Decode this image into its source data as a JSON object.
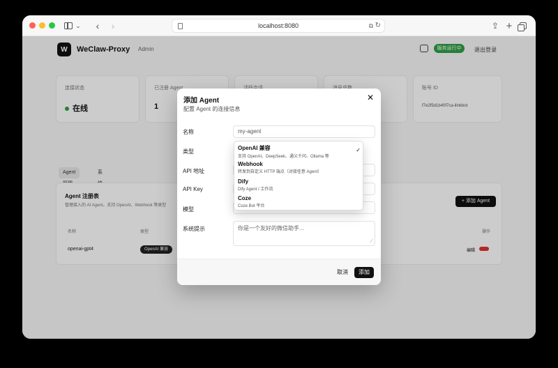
{
  "browser": {
    "url": "localhost:8080"
  },
  "app": {
    "name": "WeClaw-Proxy",
    "admin_label": "Admin",
    "status_pill": "服务运行中",
    "logout": "退出登录"
  },
  "stats": [
    {
      "label": "连接状态",
      "value": "在线"
    },
    {
      "label": "已注册 Agent",
      "value": "1"
    },
    {
      "label": "活跃会话",
      "value": ""
    },
    {
      "label": "消息总数",
      "value": ""
    },
    {
      "label": "账号 ID",
      "value": "f7e2f5d1b40f7ca-ilinkbot"
    }
  ],
  "tabs": [
    "Agent 管理",
    "系统状态"
  ],
  "agent_panel": {
    "title": "Agent 注册表",
    "desc": "管理接入的 AI Agent，支持 OpenAI、Webhook 等类型",
    "add_button": "+ 添加 Agent",
    "columns": [
      "名称",
      "类型",
      "操作"
    ],
    "row": {
      "name": "openai-gpt4",
      "type": "OpenAI 兼容",
      "edit": "编辑"
    }
  },
  "modal": {
    "title": "添加 Agent",
    "subtitle": "配置 Agent 的连接信息",
    "fields": {
      "name_label": "名称",
      "name_value": "my-agent",
      "type_label": "类型",
      "api_label": "API 地址",
      "key_label": "API Key",
      "model_label": "模型",
      "prompt_label": "系统提示",
      "prompt_placeholder": "你是一个友好的微信助手..."
    },
    "cancel": "取消",
    "submit": "添加"
  },
  "dropdown": {
    "selected": "OpenAI 兼容",
    "options": [
      {
        "title": "OpenAI 兼容",
        "desc": "支持 OpenAI、DeepSeek、通义千问、Ollama 等"
      },
      {
        "title": "Webhook",
        "desc": "转发到自定义 HTTP 端点（对接任意 Agent）"
      },
      {
        "title": "Dify",
        "desc": "Dify Agent / 工作流"
      },
      {
        "title": "Coze",
        "desc": "Coze Bot 平台"
      }
    ]
  }
}
